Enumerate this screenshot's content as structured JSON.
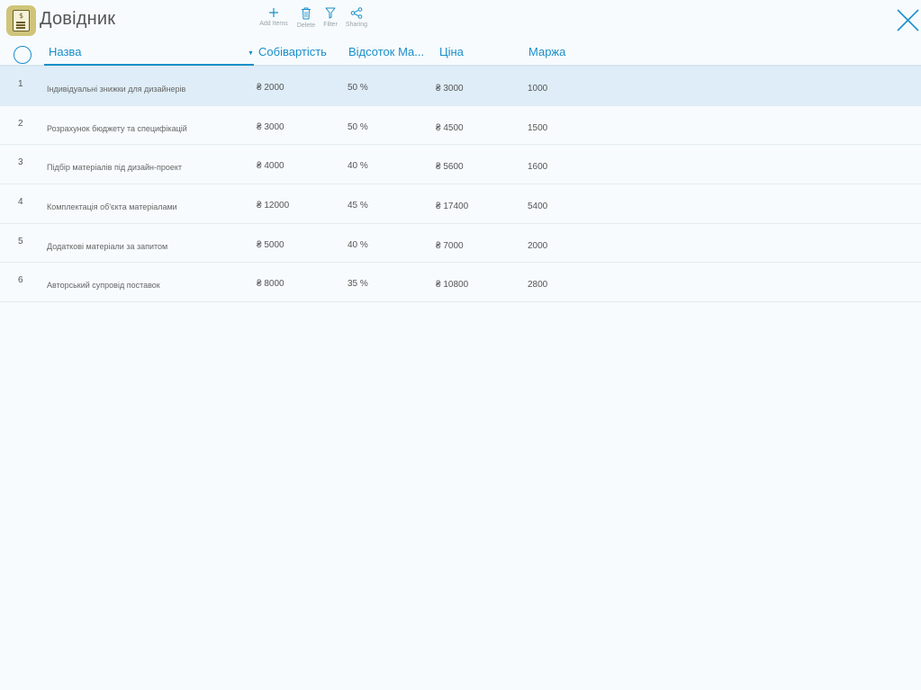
{
  "header": {
    "title": "Довідник",
    "toolbar": [
      {
        "label": "Add Items",
        "icon": "plus-icon"
      },
      {
        "label": "Delete",
        "icon": "trash-icon"
      },
      {
        "label": "Filter",
        "icon": "filter-icon"
      },
      {
        "label": "Sharing",
        "icon": "share-icon"
      }
    ],
    "accent_color": "#1a8fc9"
  },
  "table": {
    "columns": [
      "Назва",
      "Собівартість",
      "Відсоток Ма...",
      "Ціна",
      "Маржа"
    ],
    "rows": [
      {
        "num": "1",
        "name": "Індивідуальні знижки для дизайнерів",
        "cost": "₴ 2000",
        "pct": "50 %",
        "price": "₴ 3000",
        "margin": "1000"
      },
      {
        "num": "2",
        "name": "Розрахунок бюджету та специфікацій",
        "cost": "₴ 3000",
        "pct": "50 %",
        "price": "₴ 4500",
        "margin": "1500"
      },
      {
        "num": "3",
        "name": "Підбір матеріалів під дизайн-проект",
        "cost": "₴ 4000",
        "pct": "40 %",
        "price": "₴ 5600",
        "margin": "1600"
      },
      {
        "num": "4",
        "name": "Комплектація об'єкта матеріалами",
        "cost": "₴ 12000",
        "pct": "45 %",
        "price": "₴ 17400",
        "margin": "5400"
      },
      {
        "num": "5",
        "name": "Додаткові матеріали за запитом",
        "cost": "₴ 5000",
        "pct": "40 %",
        "price": "₴ 7000",
        "margin": "2000"
      },
      {
        "num": "6",
        "name": "Авторський супровід поставок",
        "cost": "₴ 8000",
        "pct": "35 %",
        "price": "₴ 10800",
        "margin": "2800"
      }
    ]
  }
}
